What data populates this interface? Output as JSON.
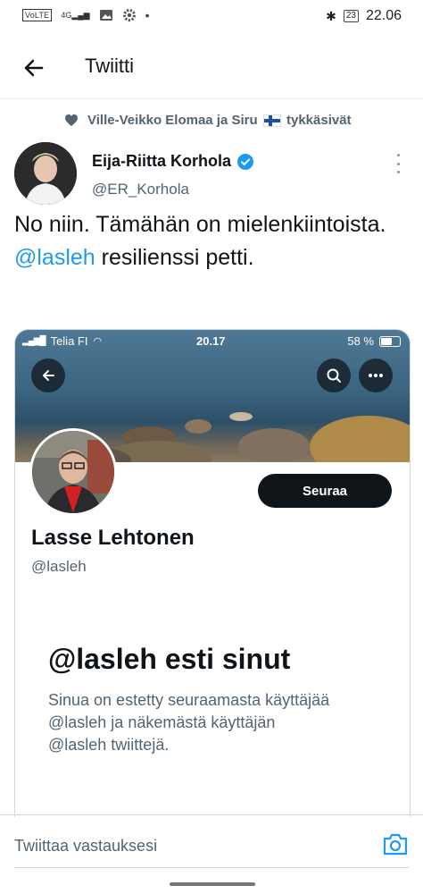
{
  "status_bar": {
    "volte": "VoLTE",
    "network": "4G",
    "time": "22.06",
    "battery": "23"
  },
  "header": {
    "title": "Twiitti"
  },
  "liked_by": {
    "text": "Ville-Veikko Elomaa ja Siru",
    "suffix": "tykkäsivät"
  },
  "tweet": {
    "author_name": "Eija-Riitta Korhola",
    "author_handle": "@ER_Korhola",
    "text_part1": "No niin. Tämähän on mielenkiintoista.",
    "mention": "@lasleh",
    "text_part2": "resilienssi petti."
  },
  "embedded_screenshot": {
    "status": {
      "carrier": "Telia FI",
      "time": "20.17",
      "battery": "58 %"
    },
    "follow_label": "Seuraa",
    "profile_name": "Lasse Lehtonen",
    "profile_handle": "@lasleh",
    "blocked_title": "@lasleh esti sinut",
    "blocked_message": "Sinua on estetty seuraamasta käyttäjää @lasleh ja näkemästä käyttäjän @lasleh twiittejä."
  },
  "reply": {
    "placeholder": "Twiittaa vastauksesi"
  }
}
